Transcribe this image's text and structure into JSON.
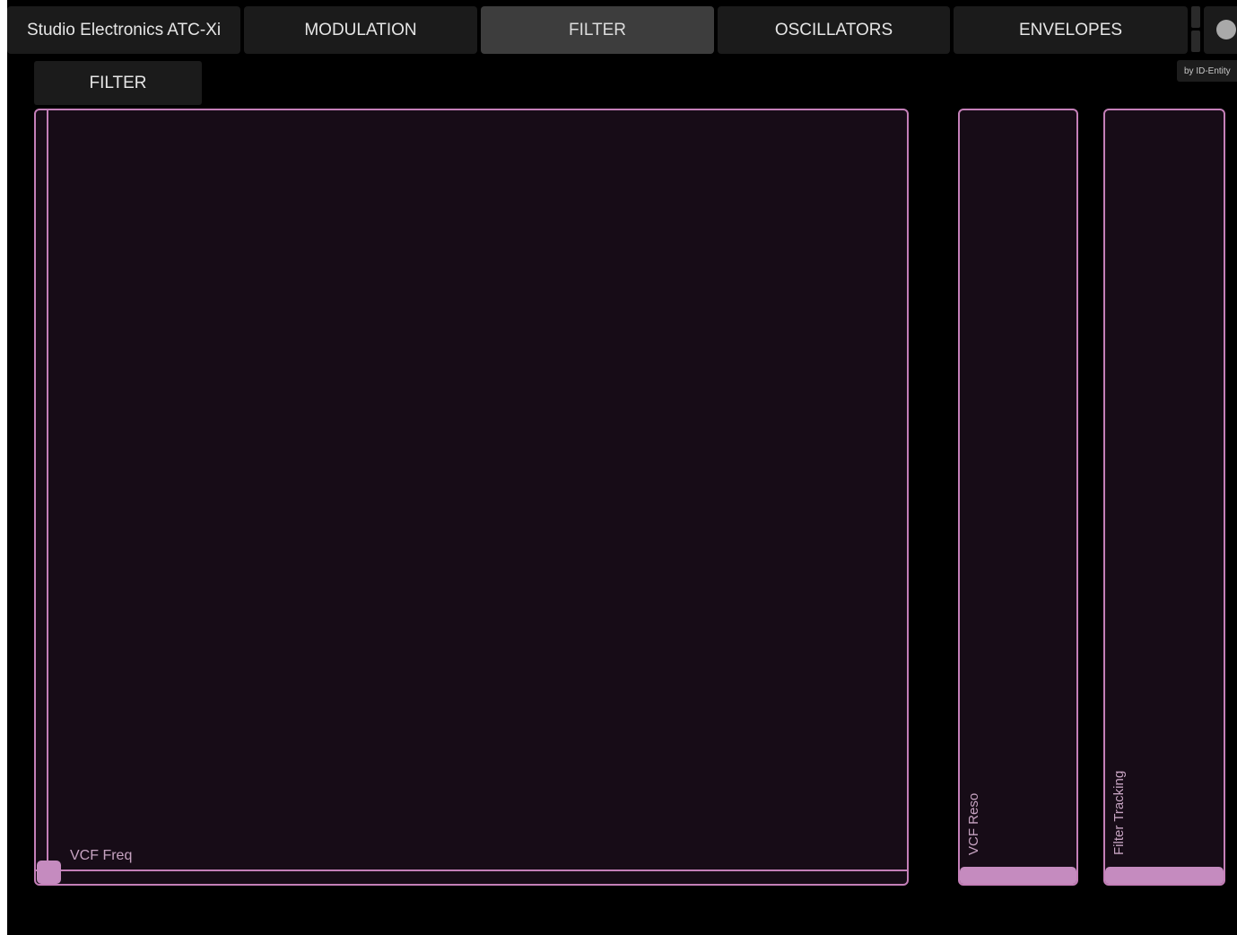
{
  "app_title": "Studio Electronics ATC-Xi",
  "tabs": [
    {
      "label": "MODULATION",
      "active": false
    },
    {
      "label": "FILTER",
      "active": true
    },
    {
      "label": "OSCILLATORS",
      "active": false
    },
    {
      "label": "ENVELOPES",
      "active": false
    }
  ],
  "credit": "by ID-Entity",
  "section_tab": "FILTER",
  "xy_pad": {
    "label": "VCF Freq",
    "x_value": 0.0,
    "y_value": 0.0
  },
  "sliders": [
    {
      "label": "VCF Reso",
      "value": 0.0
    },
    {
      "label": "Filter Tracking",
      "value": 0.0
    }
  ],
  "colors": {
    "accent": "#c47fb8",
    "pad_bg": "#170c17",
    "tab_bg": "#1b1b1b",
    "tab_active_bg": "#3d3d3d"
  }
}
